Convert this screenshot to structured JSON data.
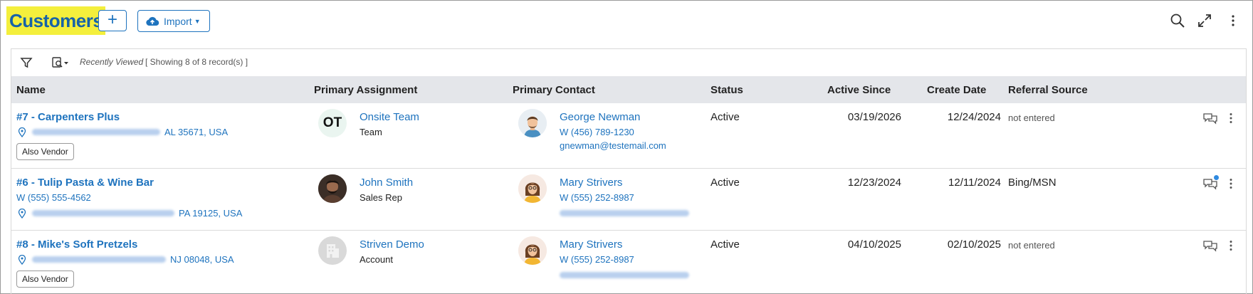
{
  "header": {
    "title": "Customers",
    "add_label": "+",
    "import_label": "Import",
    "icons": [
      "search-icon",
      "expand-icon",
      "more-vertical-icon"
    ]
  },
  "toolbar": {
    "recently_viewed": "Recently Viewed",
    "showing": "[ Showing 8 of 8 record(s) ]"
  },
  "columns": {
    "name": "Name",
    "assignment": "Primary Assignment",
    "contact": "Primary Contact",
    "status": "Status",
    "active_since": "Active Since",
    "create_date": "Create Date",
    "referral": "Referral Source"
  },
  "rows": [
    {
      "name": "#7 - Carpenters Plus",
      "address_tail": "AL 35671, USA",
      "badge": "Also Vendor",
      "assignment": {
        "initials": "OT",
        "name": "Onsite Team",
        "role": "Team"
      },
      "contact": {
        "name": "George Newman",
        "phone": "W (456) 789-1230",
        "email": "gnewman@testemail.com"
      },
      "status": "Active",
      "active_since": "03/19/2026",
      "create_date": "12/24/2024",
      "referral": "not entered"
    },
    {
      "name": "#6 - Tulip Pasta & Wine Bar",
      "phone": "W (555) 555-4562",
      "address_tail": "PA 19125, USA",
      "assignment": {
        "name": "John Smith",
        "role": "Sales Rep"
      },
      "contact": {
        "name": "Mary Strivers",
        "phone": "W (555) 252-8987"
      },
      "status": "Active",
      "active_since": "12/23/2024",
      "create_date": "12/11/2024",
      "referral": "Bing/MSN"
    },
    {
      "name": "#8 - Mike's Soft Pretzels",
      "address_tail": "NJ 08048, USA",
      "badge": "Also Vendor",
      "assignment": {
        "name": "Striven Demo",
        "role": "Account"
      },
      "contact": {
        "name": "Mary Strivers",
        "phone": "W (555) 252-8987"
      },
      "status": "Active",
      "active_since": "04/10/2025",
      "create_date": "02/10/2025",
      "referral": "not entered"
    }
  ],
  "colors": {
    "accent": "#1e73be",
    "title_bg": "#f4ef3c",
    "title_text": "#1763a8",
    "header_row": "#e4e6ea"
  }
}
